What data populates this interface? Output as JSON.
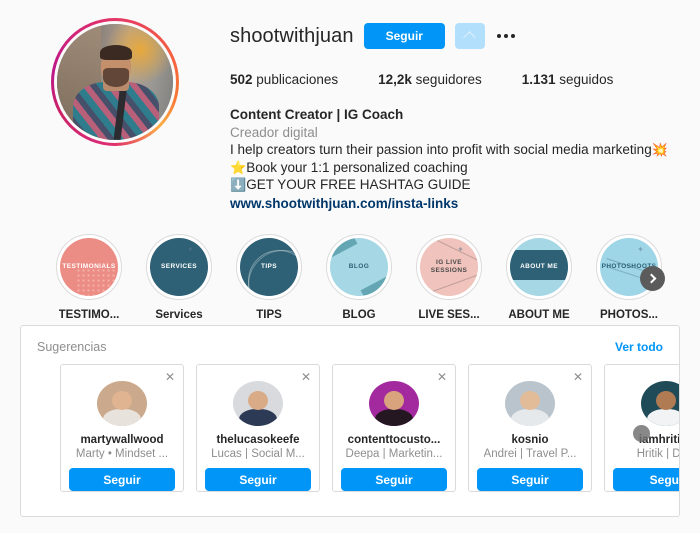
{
  "profile": {
    "username": "shootwithjuan",
    "follow_button": "Seguir",
    "caret_icon": "chevron-up-icon",
    "more_icon": "more-options-icon",
    "stats": [
      {
        "value": "502",
        "label": "publicaciones"
      },
      {
        "value": "12,2k",
        "label": "seguidores"
      },
      {
        "value": "1.131",
        "label": "seguidos"
      }
    ],
    "bio": {
      "title": "Content Creator | IG Coach",
      "category": "Creador digital",
      "line1": "I help creators turn their passion into profit with social media marketing",
      "line1_emoji": "💥",
      "line2_emoji": "⭐",
      "line2": "Book your 1:1 personalized coaching",
      "line3_emoji": "⬇️",
      "line3": "GET YOUR FREE HASHTAG GUIDE",
      "link": "www.shootwithjuan.com/insta-links"
    }
  },
  "highlights": [
    {
      "label": "TESTIMO...",
      "cover_text": "TESTIMONIALS",
      "bg": "#ec8d85",
      "fg": "#ffffff",
      "style": "dots"
    },
    {
      "label": "Services",
      "cover_text": "SERVICES",
      "bg": "#2e6175",
      "fg": "#ffffff",
      "style": "spark"
    },
    {
      "label": "TIPS",
      "cover_text": "TIPS",
      "bg": "#2e6175",
      "fg": "#ffffff",
      "style": "swoosh"
    },
    {
      "label": "BLOG",
      "cover_text": "BLOG",
      "bg": "#a5d8e4",
      "fg": "#2e6175",
      "style": "corners"
    },
    {
      "label": "LIVE SES...",
      "cover_text": "IG LIVE SESSIONS",
      "bg": "#f0c3bc",
      "fg": "#4a4a4a",
      "style": "lines"
    },
    {
      "label": "ABOUT ME",
      "cover_text": "ABOUT ME",
      "bg": "#a5d8e4",
      "fg": "#ffffff",
      "style": "band"
    },
    {
      "label": "PHOTOS...",
      "cover_text": "PHOTOSHOOTS",
      "bg": "#9ed6e8",
      "fg": "#2e6175",
      "style": "thin"
    }
  ],
  "highlights_next_icon": "chevron-right-icon",
  "suggestions": {
    "title": "Sugerencias",
    "see_all": "Ver todo",
    "close_icon": "close-icon",
    "cards": [
      {
        "username": "martywallwood",
        "subtitle": "Marty • Mindset ...",
        "button": "Seguir",
        "av_bg": "#caa98c",
        "av_face": "#e0b490",
        "av_torso": "#e8e2dc"
      },
      {
        "username": "thelucasokeefe",
        "subtitle": "Lucas | Social M...",
        "button": "Seguir",
        "av_bg": "#d8dade",
        "av_face": "#d9ab87",
        "av_torso": "#2c3a56"
      },
      {
        "username": "contenttocusto...",
        "subtitle": "Deepa | Marketin...",
        "button": "Seguir",
        "av_bg": "#a32a9e",
        "av_face": "#d9a37e",
        "av_torso": "#241722"
      },
      {
        "username": "kosnio",
        "subtitle": "Andrei | Travel P...",
        "button": "Seguir",
        "av_bg": "#b9c4cc",
        "av_face": "#e2bb99",
        "av_torso": "#e6e9ec"
      },
      {
        "username": "iamhritiks",
        "subtitle": "Hritik | Digit",
        "button": "Segui",
        "av_bg": "#1f4a58",
        "av_face": "#b07a53",
        "av_torso": "#f2f3f5"
      }
    ]
  },
  "colors": {
    "accent": "#0095f6",
    "link": "#00376b",
    "muted": "#8e8e8e",
    "border": "#dbdbdb",
    "background": "#fafafa"
  }
}
